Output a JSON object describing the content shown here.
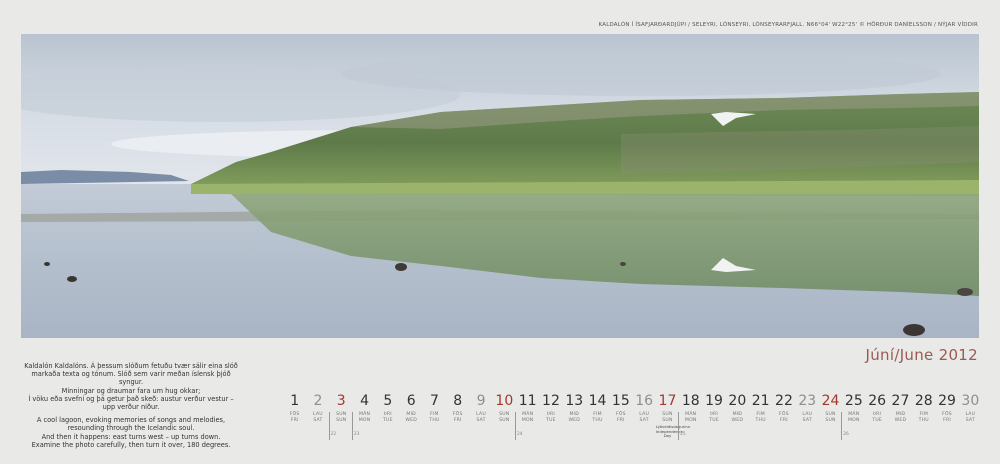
{
  "caption": "KALDALÓN Í ÍSAFJARÐARDJÚPI / SELEYRI, LÓNSEYRI, LÓNSEYRARFJALL. N66°04' W22°25' © HÖRÐUR DANÍELSSON / NÝJAR VÍDDIR",
  "month": "Júní/June 2012",
  "poem": {
    "is": [
      "Kaldalón Kaldalóns. Á þessum slóðum fetuðu tvær sálir eina slóð",
      "markaða texta og tónum. Slóð sem varir meðan íslensk þjóð syngur.",
      "Minningar og draumar fara um hug okkar;",
      "Í vöku eða svefni og þá getur það skeð: austur verður vestur – upp verður niður."
    ],
    "en": [
      "A cool lagoon, evoking memories of songs and melodies,",
      "resounding through the Icelandic soul.",
      "And then it happens: east turns west – up turns down.",
      "Examine the photo carefully, then turn it over, 180 degrees."
    ]
  },
  "days": [
    {
      "n": "1",
      "wd": [
        "FÖS",
        "FRI"
      ],
      "type": "fri"
    },
    {
      "n": "2",
      "wd": [
        "LAU",
        "SAT"
      ],
      "type": "sat"
    },
    {
      "n": "3",
      "wd": [
        "SUN",
        "SUN"
      ],
      "type": "sun",
      "wk": "22"
    },
    {
      "n": "4",
      "wd": [
        "MÁN",
        "MON"
      ],
      "type": "wd",
      "wk": "23"
    },
    {
      "n": "5",
      "wd": [
        "ÞRI",
        "TUE"
      ],
      "type": "wd"
    },
    {
      "n": "6",
      "wd": [
        "MIÐ",
        "WED"
      ],
      "type": "wd"
    },
    {
      "n": "7",
      "wd": [
        "FIM",
        "THU"
      ],
      "type": "wd"
    },
    {
      "n": "8",
      "wd": [
        "FÖS",
        "FRI"
      ],
      "type": "fri"
    },
    {
      "n": "9",
      "wd": [
        "LAU",
        "SAT"
      ],
      "type": "sat"
    },
    {
      "n": "10",
      "wd": [
        "SUN",
        "SUN"
      ],
      "type": "sun"
    },
    {
      "n": "11",
      "wd": [
        "MÁN",
        "MON"
      ],
      "type": "wd",
      "wk": "24"
    },
    {
      "n": "12",
      "wd": [
        "ÞRI",
        "TUE"
      ],
      "type": "wd"
    },
    {
      "n": "13",
      "wd": [
        "MIÐ",
        "WED"
      ],
      "type": "wd"
    },
    {
      "n": "14",
      "wd": [
        "FIM",
        "THU"
      ],
      "type": "wd"
    },
    {
      "n": "15",
      "wd": [
        "FÖS",
        "FRI"
      ],
      "type": "fri"
    },
    {
      "n": "16",
      "wd": [
        "LAU",
        "SAT"
      ],
      "type": "sat"
    },
    {
      "n": "17",
      "wd": [
        "SUN",
        "SUN"
      ],
      "type": "sun",
      "note": [
        "Lýðveldisdagurinn",
        "Independence Day"
      ]
    },
    {
      "n": "18",
      "wd": [
        "MÁN",
        "MON"
      ],
      "type": "wd",
      "wk": "25"
    },
    {
      "n": "19",
      "wd": [
        "ÞRI",
        "TUE"
      ],
      "type": "wd"
    },
    {
      "n": "20",
      "wd": [
        "MIÐ",
        "WED"
      ],
      "type": "wd"
    },
    {
      "n": "21",
      "wd": [
        "FIM",
        "THU"
      ],
      "type": "wd"
    },
    {
      "n": "22",
      "wd": [
        "FÖS",
        "FRI"
      ],
      "type": "fri"
    },
    {
      "n": "23",
      "wd": [
        "LAU",
        "SAT"
      ],
      "type": "sat"
    },
    {
      "n": "24",
      "wd": [
        "SUN",
        "SUN"
      ],
      "type": "sun"
    },
    {
      "n": "25",
      "wd": [
        "MÁN",
        "MON"
      ],
      "type": "wd",
      "wk": "26"
    },
    {
      "n": "26",
      "wd": [
        "ÞRI",
        "TUE"
      ],
      "type": "wd"
    },
    {
      "n": "27",
      "wd": [
        "MIÐ",
        "WED"
      ],
      "type": "wd"
    },
    {
      "n": "28",
      "wd": [
        "FIM",
        "THU"
      ],
      "type": "wd"
    },
    {
      "n": "29",
      "wd": [
        "FÖS",
        "FRI"
      ],
      "type": "fri"
    },
    {
      "n": "30",
      "wd": [
        "LAU",
        "SAT"
      ],
      "type": "sat"
    }
  ]
}
